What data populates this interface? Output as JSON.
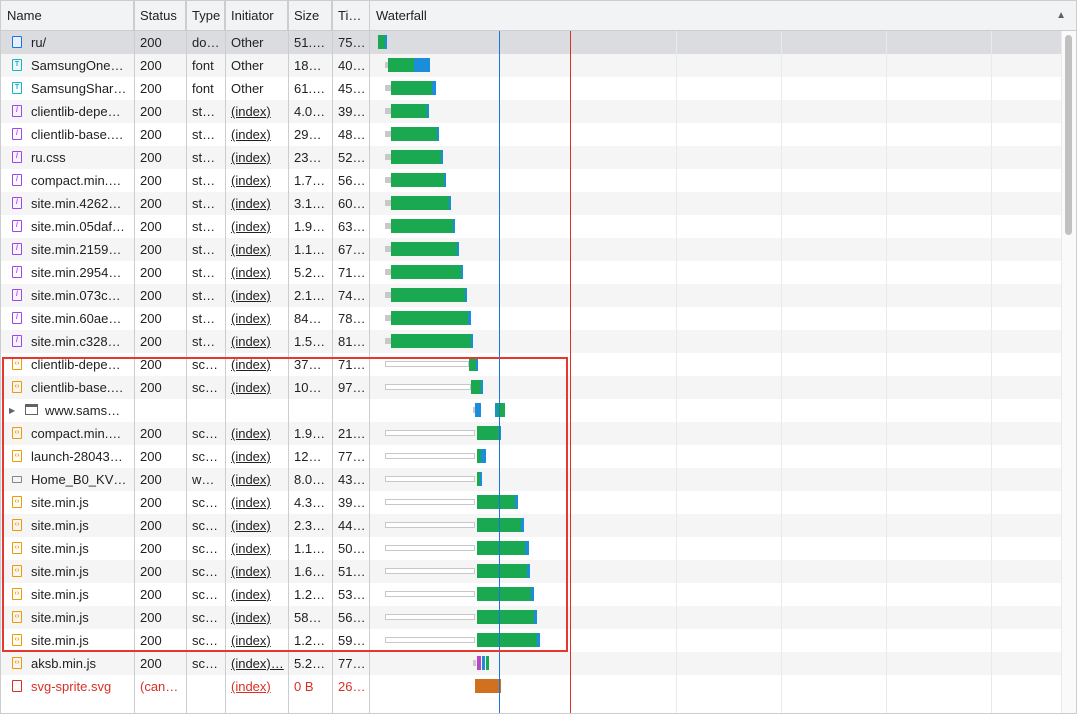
{
  "columns": {
    "name": "Name",
    "status": "Status",
    "type": "Type",
    "initiator": "Initiator",
    "size": "Size",
    "time": "Ti…",
    "waterfall": "Waterfall"
  },
  "sort_icon": "triangle-up-icon",
  "colors": {
    "accent_blue": "#1a73e8",
    "error_red": "#d93025",
    "bar_green": "#1aa851",
    "bar_blue": "#1a8ddb",
    "highlight": "#e8372f"
  },
  "rows": [
    {
      "name": "ru/",
      "status": "200",
      "type": "do…",
      "initiator": "Other",
      "size": "51.…",
      "time": "75…",
      "icon": "document-icon"
    },
    {
      "name": "SamsungOne…",
      "status": "200",
      "type": "font",
      "initiator": "Other",
      "size": "18…",
      "time": "40…",
      "icon": "font-icon"
    },
    {
      "name": "SamsungShar…",
      "status": "200",
      "type": "font",
      "initiator": "Other",
      "size": "61.…",
      "time": "45…",
      "icon": "font-icon"
    },
    {
      "name": "clientlib-depe…",
      "status": "200",
      "type": "st…",
      "initiator": "(index)",
      "size": "4.0…",
      "time": "39…",
      "icon": "stylesheet-icon"
    },
    {
      "name": "clientlib-base.…",
      "status": "200",
      "type": "st…",
      "initiator": "(index)",
      "size": "29…",
      "time": "48…",
      "icon": "stylesheet-icon"
    },
    {
      "name": "ru.css",
      "status": "200",
      "type": "st…",
      "initiator": "(index)",
      "size": "23…",
      "time": "52…",
      "icon": "stylesheet-icon"
    },
    {
      "name": "compact.min.…",
      "status": "200",
      "type": "st…",
      "initiator": "(index)",
      "size": "1.7…",
      "time": "56…",
      "icon": "stylesheet-icon"
    },
    {
      "name": "site.min.4262…",
      "status": "200",
      "type": "st…",
      "initiator": "(index)",
      "size": "3.1…",
      "time": "60…",
      "icon": "stylesheet-icon"
    },
    {
      "name": "site.min.05daf…",
      "status": "200",
      "type": "st…",
      "initiator": "(index)",
      "size": "1.9…",
      "time": "63…",
      "icon": "stylesheet-icon"
    },
    {
      "name": "site.min.2159…",
      "status": "200",
      "type": "st…",
      "initiator": "(index)",
      "size": "1.1…",
      "time": "67…",
      "icon": "stylesheet-icon"
    },
    {
      "name": "site.min.2954…",
      "status": "200",
      "type": "st…",
      "initiator": "(index)",
      "size": "5.2…",
      "time": "71…",
      "icon": "stylesheet-icon"
    },
    {
      "name": "site.min.073c…",
      "status": "200",
      "type": "st…",
      "initiator": "(index)",
      "size": "2.1…",
      "time": "74…",
      "icon": "stylesheet-icon"
    },
    {
      "name": "site.min.60ae…",
      "status": "200",
      "type": "st…",
      "initiator": "(index)",
      "size": "84…",
      "time": "78…",
      "icon": "stylesheet-icon"
    },
    {
      "name": "site.min.c328…",
      "status": "200",
      "type": "st…",
      "initiator": "(index)",
      "size": "1.5…",
      "time": "81…",
      "icon": "stylesheet-icon"
    },
    {
      "name": "clientlib-depe…",
      "status": "200",
      "type": "sc…",
      "initiator": "(index)",
      "size": "37…",
      "time": "71…",
      "icon": "script-icon"
    },
    {
      "name": "clientlib-base.…",
      "status": "200",
      "type": "sc…",
      "initiator": "(index)",
      "size": "10…",
      "time": "97…",
      "icon": "script-icon"
    },
    {
      "name": "www.sams…",
      "status": "",
      "type": "",
      "initiator": "",
      "size": "",
      "time": "",
      "icon": "frame-icon"
    },
    {
      "name": "compact.min.…",
      "status": "200",
      "type": "sc…",
      "initiator": "(index)",
      "size": "1.9…",
      "time": "21…",
      "icon": "script-icon"
    },
    {
      "name": "launch-28043…",
      "status": "200",
      "type": "sc…",
      "initiator": "(index)",
      "size": "12…",
      "time": "77…",
      "icon": "script-icon"
    },
    {
      "name": "Home_B0_KV…",
      "status": "200",
      "type": "w…",
      "initiator": "(index)",
      "size": "8.0…",
      "time": "43…",
      "icon": "image-icon"
    },
    {
      "name": "site.min.js",
      "status": "200",
      "type": "sc…",
      "initiator": "(index)",
      "size": "4.3…",
      "time": "39…",
      "icon": "script-icon"
    },
    {
      "name": "site.min.js",
      "status": "200",
      "type": "sc…",
      "initiator": "(index)",
      "size": "2.3…",
      "time": "44…",
      "icon": "script-icon"
    },
    {
      "name": "site.min.js",
      "status": "200",
      "type": "sc…",
      "initiator": "(index)",
      "size": "1.1…",
      "time": "50…",
      "icon": "script-icon"
    },
    {
      "name": "site.min.js",
      "status": "200",
      "type": "sc…",
      "initiator": "(index)",
      "size": "1.6…",
      "time": "51…",
      "icon": "script-icon"
    },
    {
      "name": "site.min.js",
      "status": "200",
      "type": "sc…",
      "initiator": "(index)",
      "size": "1.2…",
      "time": "53…",
      "icon": "script-icon"
    },
    {
      "name": "site.min.js",
      "status": "200",
      "type": "sc…",
      "initiator": "(index)",
      "size": "58…",
      "time": "56…",
      "icon": "script-icon"
    },
    {
      "name": "site.min.js",
      "status": "200",
      "type": "sc…",
      "initiator": "(index)",
      "size": "1.2…",
      "time": "59…",
      "icon": "script-icon"
    },
    {
      "name": "aksb.min.js",
      "status": "200",
      "type": "sc…",
      "initiator": "(index)…",
      "size": "5.2…",
      "time": "77…",
      "icon": "script-icon"
    },
    {
      "name": "svg-sprite.svg",
      "status": "(can…",
      "type": "",
      "initiator": "(index)",
      "size": "0 B",
      "time": "26…",
      "icon": "svg-icon",
      "error": true
    }
  ]
}
